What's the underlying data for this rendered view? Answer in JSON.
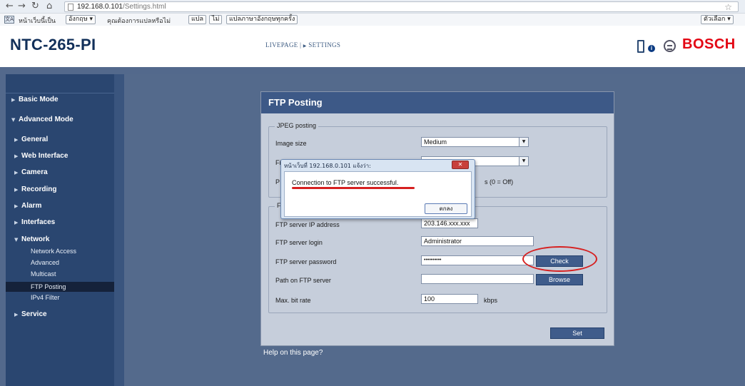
{
  "browser": {
    "back_icon": "back-arrow-icon",
    "forward_icon": "forward-arrow-icon",
    "reload_icon": "reload-icon",
    "home_icon": "home-icon",
    "url_host": "192.168.0.101",
    "url_path": "/Settings.html",
    "star_icon": "bookmark-star-icon"
  },
  "translate_bar": {
    "prefix": "หน้าเว็บนี้เป็น",
    "language": "อังกฤษ ▾",
    "question": "คุณต้องการแปลหรือไม่",
    "translate_btn": "แปล",
    "no_btn": "ไม่",
    "always_btn": "แปลภาษาอังกฤษทุกครั้ง",
    "options_btn": "ตัวเลือก ▾"
  },
  "header": {
    "product": "NTC-265-PI",
    "crumb_live": "LIVEPAGE",
    "crumb_sep": " | ",
    "crumb_arrow": "▶",
    "crumb_settings": "SETTINGS",
    "brand": "BOSCH"
  },
  "sidebar": {
    "basic_mode": "Basic Mode",
    "advanced_mode": "Advanced Mode",
    "items": [
      "General",
      "Web Interface",
      "Camera",
      "Recording",
      "Alarm",
      "Interfaces",
      "Network"
    ],
    "network_children": [
      "Network Access",
      "Advanced",
      "Multicast",
      "FTP Posting",
      "IPv4 Filter"
    ],
    "service": "Service",
    "active_child": "FTP Posting"
  },
  "panel": {
    "title": "FTP Posting",
    "jpeg_legend": "JPEG posting",
    "image_size_label": "Image size",
    "image_size_value": "Medium",
    "file_label": "Fi",
    "posting_label": "P",
    "interval_unit": "s (0 = Off)",
    "ftp_legend": "F",
    "server_ip_label": "FTP server IP address",
    "server_ip_value": "203.146.xxx.xxx",
    "login_label": "FTP server login",
    "login_value": "Administrator",
    "password_label": "FTP server password",
    "password_value": "••••••••••",
    "check_btn": "Check",
    "path_label": "Path on FTP server",
    "path_value": "",
    "browse_btn": "Browse",
    "bitrate_label": "Max. bit rate",
    "bitrate_value": "100",
    "bitrate_unit": "kbps",
    "set_btn": "Set",
    "help_link": "Help on this page?"
  },
  "dialog": {
    "title": "หน้าเว็บที่ 192.168.0.101 แจ้งว่า:",
    "message": "Connection to FTP server successful.",
    "ok_btn": "ตกลง",
    "close_btn": "✕"
  },
  "annotations": {
    "highlight_color": "#d62020"
  }
}
